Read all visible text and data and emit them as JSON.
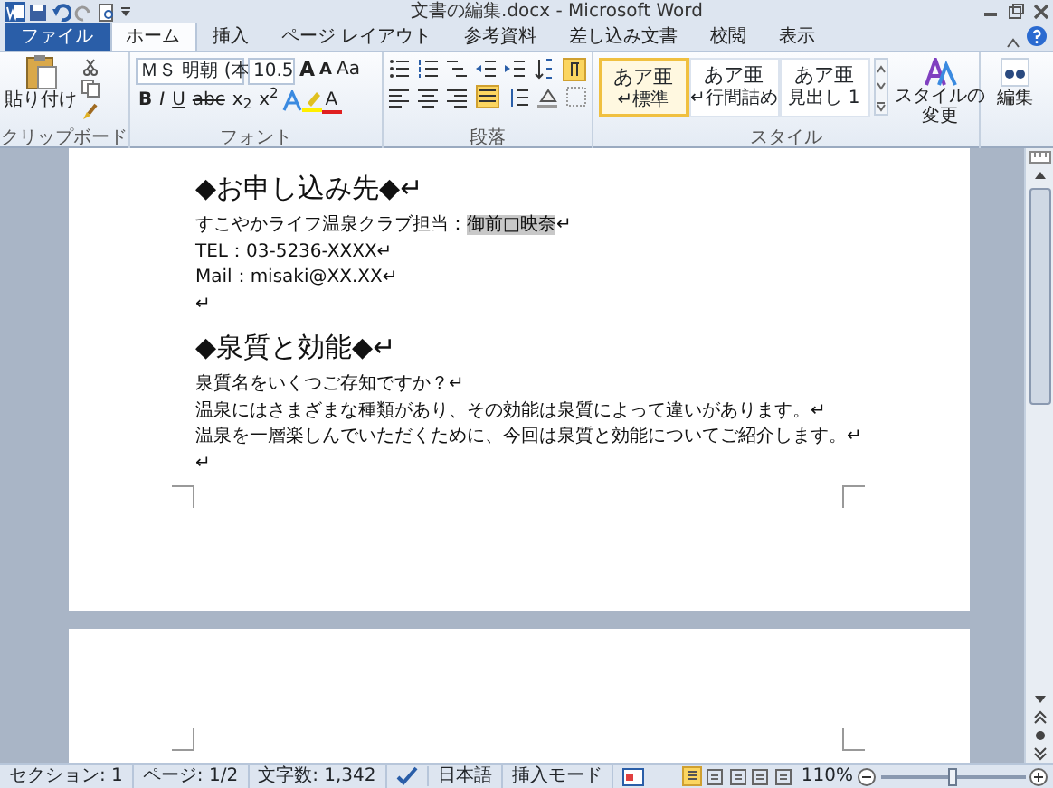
{
  "window": {
    "title": "文書の編集.docx - Microsoft Word"
  },
  "tabs": [
    {
      "label": "ファイル",
      "kind": "file",
      "selected": false
    },
    {
      "label": "ホーム",
      "kind": "tab",
      "selected": true
    },
    {
      "label": "挿入",
      "kind": "tab",
      "selected": false
    },
    {
      "label": "ページ レイアウト",
      "kind": "tab",
      "selected": false
    },
    {
      "label": "参考資料",
      "kind": "tab",
      "selected": false
    },
    {
      "label": "差し込み文書",
      "kind": "tab",
      "selected": false
    },
    {
      "label": "校閲",
      "kind": "tab",
      "selected": false
    },
    {
      "label": "表示",
      "kind": "tab",
      "selected": false
    }
  ],
  "ribbon": {
    "clipboard": {
      "paste_label": "貼り付け",
      "group_label": "クリップボード"
    },
    "font": {
      "font_name": "ＭＳ 明朝 (本",
      "font_size": "10.5",
      "size_buttons": [
        "A",
        "A"
      ],
      "case_button": "Aa",
      "format_buttons": [
        "B",
        "I",
        "U",
        "abc",
        "x$_{2}$",
        "x$^{2}$"
      ],
      "color_button": "A",
      "group_label": "フォント"
    },
    "paragraph": {
      "group_label": "段落"
    },
    "styles": {
      "items": [
        {
          "sample": "あア亜",
          "name": "↵標準",
          "selected": true
        },
        {
          "sample": "あア亜",
          "name": "↵行間詰め",
          "selected": false
        },
        {
          "sample": "あア亜",
          "name": "見出し 1",
          "selected": false
        }
      ],
      "change_label": "スタイルの変更",
      "group_label": "スタイル"
    },
    "editing": {
      "label": "編集"
    }
  },
  "document": {
    "paragraphs": [
      {
        "kind": "heading",
        "segments": [
          {
            "text": "◆お申し込み先◆↵",
            "highlighted": false
          }
        ]
      },
      {
        "kind": "body",
        "segments": [
          {
            "text": "すこやかライフ温泉クラブ担当：",
            "highlighted": false
          },
          {
            "text": "御前□映奈",
            "highlighted": true
          },
          {
            "text": "↵",
            "highlighted": false
          }
        ]
      },
      {
        "kind": "body",
        "segments": [
          {
            "text": "TEL：03-5236-XXXX↵",
            "highlighted": false
          }
        ]
      },
      {
        "kind": "body",
        "segments": [
          {
            "text": "Mail：misaki@XX.XX↵",
            "highlighted": false
          }
        ]
      },
      {
        "kind": "body",
        "segments": [
          {
            "text": "↵",
            "highlighted": false
          }
        ]
      },
      {
        "kind": "heading",
        "segments": [
          {
            "text": "◆泉質と効能◆↵",
            "highlighted": false
          }
        ]
      },
      {
        "kind": "body",
        "segments": [
          {
            "text": "泉質名をいくつご存知ですか？↵",
            "highlighted": false
          }
        ]
      },
      {
        "kind": "body",
        "segments": [
          {
            "text": "温泉にはさまざまな種類があり、その効能は泉質によって違いがあります。↵",
            "highlighted": false
          }
        ]
      },
      {
        "kind": "body",
        "segments": [
          {
            "text": "温泉を一層楽しんでいただくために、今回は泉質と効能についてご紹介します。↵",
            "highlighted": false
          }
        ]
      },
      {
        "kind": "body",
        "segments": [
          {
            "text": "↵",
            "highlighted": false
          }
        ]
      }
    ]
  },
  "status_bar": {
    "section": "セクション: 1",
    "page": "ページ: 1/2",
    "word_count": "文字数: 1,342",
    "language": "日本語",
    "mode": "挿入モード",
    "zoom": "110%",
    "zoom_slider": {
      "level": 0.5
    }
  }
}
